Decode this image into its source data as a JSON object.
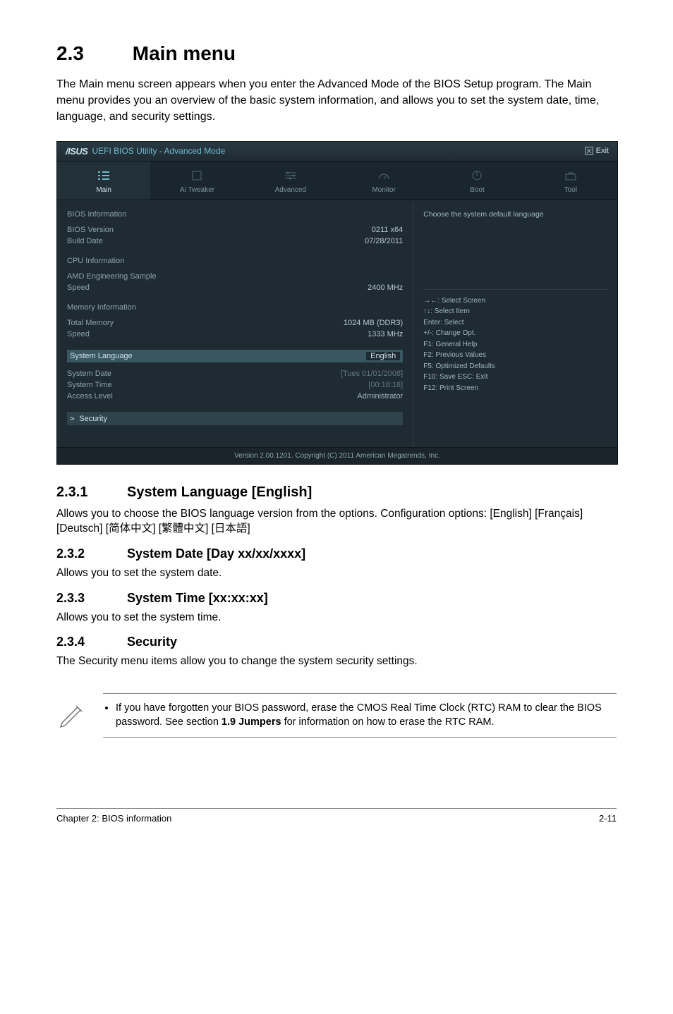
{
  "heading": {
    "num": "2.3",
    "title": "Main menu"
  },
  "intro": "The Main menu screen appears when you enter the Advanced Mode of the BIOS Setup program. The Main menu provides you an overview of the basic system information, and allows you to set the system date, time, language, and security settings.",
  "bios": {
    "logo": "/ISUS",
    "title": "UEFI BIOS Utility - Advanced Mode",
    "exit": "Exit",
    "tabs": [
      "Main",
      "Ai Tweaker",
      "Advanced",
      "Monitor",
      "Boot",
      "Tool"
    ],
    "left": {
      "bios_info": {
        "label": "BIOS Information",
        "rows": [
          {
            "k": "BIOS Version",
            "v": "0211 x64"
          },
          {
            "k": "Build Date",
            "v": "07/28/2011"
          }
        ]
      },
      "cpu_info": {
        "label": "CPU Information",
        "rows": [
          {
            "k": "AMD Engineering Sample",
            "v": ""
          },
          {
            "k": "Speed",
            "v": "2400 MHz"
          }
        ]
      },
      "mem_info": {
        "label": "Memory Information",
        "rows": [
          {
            "k": "Total Memory",
            "v": "1024 MB (DDR3)"
          },
          {
            "k": "Speed",
            "v": "1333 MHz"
          }
        ]
      },
      "lang": {
        "k": "System Language",
        "v": "English"
      },
      "date": {
        "k": "System Date",
        "v": "[Tues 01/01/2008]"
      },
      "time": {
        "k": "System Time",
        "v": "[00:18:18]"
      },
      "access": {
        "k": "Access Level",
        "v": "Administrator"
      },
      "security": "Security"
    },
    "right": {
      "help_top": "Choose the system default language",
      "keys": [
        "→←: Select Screen",
        "↑↓: Select Item",
        "Enter: Select",
        "+/-: Change Opt.",
        "F1: General Help",
        "F2: Previous Values",
        "F5: Optimized Defaults",
        "F10: Save  ESC: Exit",
        "F12: Print Screen"
      ]
    },
    "footer": "Version 2.00.1201.  Copyright (C) 2011 American Megatrends, Inc."
  },
  "sections": {
    "s231": {
      "num": "2.3.1",
      "title": "System Language [English]",
      "body": "Allows you to choose the BIOS language version from the options. Configuration options: [English] [Français] [Deutsch] [简体中文] [繁體中文] [日本語]"
    },
    "s232": {
      "num": "2.3.2",
      "title": "System Date [Day xx/xx/xxxx]",
      "body": "Allows you to set the system date."
    },
    "s233": {
      "num": "2.3.3",
      "title": "System Time [xx:xx:xx]",
      "body": "Allows you to set the system time."
    },
    "s234": {
      "num": "2.3.4",
      "title": "Security",
      "body": "The Security menu items allow you to change the system security settings."
    }
  },
  "note": {
    "bullet_prefix": "If you have forgotten your BIOS password, erase the CMOS Real Time Clock (RTC) RAM to clear the BIOS password. See section ",
    "bullet_bold": "1.9 Jumpers",
    "bullet_suffix": " for information on how to erase the RTC RAM."
  },
  "footer": {
    "left": "Chapter 2: BIOS information",
    "right": "2-11"
  }
}
